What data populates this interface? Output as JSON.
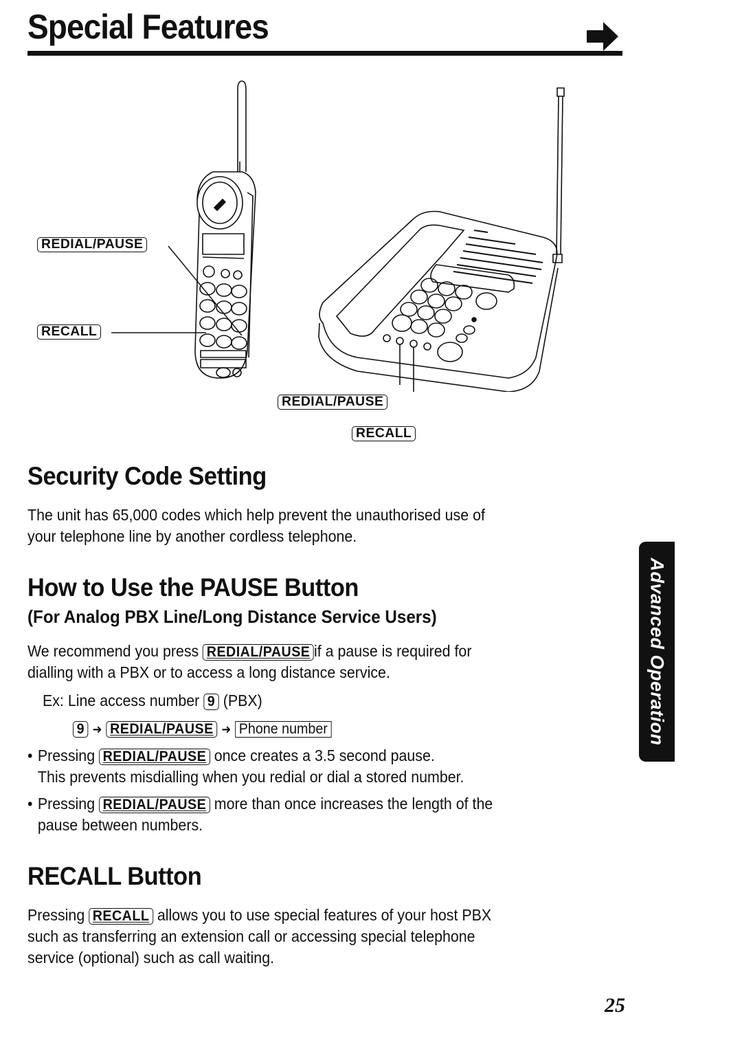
{
  "header": {
    "title": "Special Features",
    "continue_icon": "right-arrow-icon"
  },
  "figure": {
    "handset_labels": {
      "redial_pause": "REDIAL/PAUSE",
      "recall": "RECALL"
    },
    "base_labels": {
      "redial_pause": "REDIAL/PAUSE",
      "recall": "RECALL"
    }
  },
  "security": {
    "heading": "Security Code Setting",
    "body_line1": "The unit has 65,000 codes which help prevent the unauthorised use of",
    "body_line2": "your telephone line by another cordless telephone."
  },
  "pause": {
    "heading": "How to Use the PAUSE Button",
    "subheading": "(For Analog PBX Line/Long Distance Service Users)",
    "intro_pre": "We recommend you press",
    "intro_key": "REDIAL/PAUSE",
    "intro_post": "if a pause is required for",
    "intro_line2": "dialling with a PBX or to access a long distance service.",
    "example_pre": "Ex: Line access number",
    "example_key": "9",
    "example_post": "(PBX)",
    "sequence": {
      "step1": "9",
      "step2": "REDIAL/PAUSE",
      "step3": "Phone number"
    },
    "bullets": [
      {
        "pre": "Pressing",
        "key": "REDIAL/PAUSE",
        "post": "once creates a 3.5 second pause.",
        "line2": "This prevents misdialling when you redial or dial a stored number."
      },
      {
        "pre": "Pressing",
        "key": "REDIAL/PAUSE",
        "post": "more than once increases the length of the",
        "line2": "pause between numbers."
      }
    ]
  },
  "recall": {
    "heading": "RECALL Button",
    "pre": "Pressing",
    "key": "RECALL",
    "post": "allows you to use special features of your host PBX",
    "line2": "such as transferring an extension call or accessing special telephone",
    "line3": "service (optional) such as call waiting."
  },
  "side_tab": {
    "label": "Advanced Operation"
  },
  "page_number": "25"
}
